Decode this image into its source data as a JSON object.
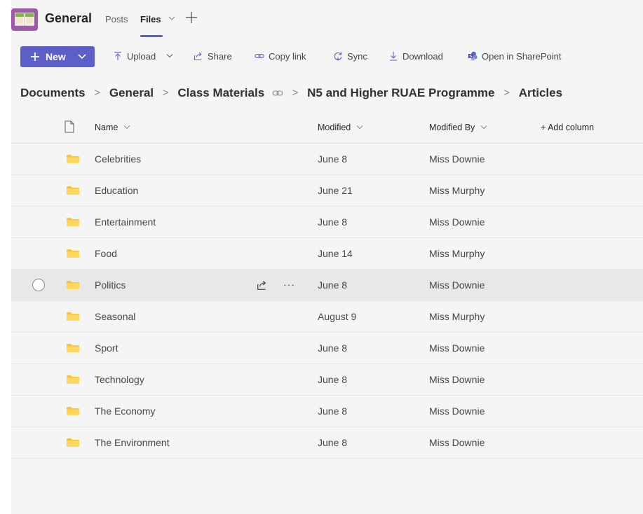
{
  "header": {
    "channel": "General",
    "tabs": [
      {
        "label": "Posts"
      },
      {
        "label": "Files"
      }
    ]
  },
  "toolbar": {
    "new_label": "New",
    "upload_label": "Upload",
    "share_label": "Share",
    "copylink_label": "Copy link",
    "sync_label": "Sync",
    "download_label": "Download",
    "sharepoint_label": "Open in SharePoint"
  },
  "breadcrumb": [
    "Documents",
    "General",
    "Class Materials",
    "N5 and Higher RUAE Programme",
    "Articles"
  ],
  "table": {
    "columns": {
      "name": "Name",
      "modified": "Modified",
      "modified_by": "Modified By",
      "add_column": "+ Add column"
    },
    "rows": [
      {
        "name": "Celebrities",
        "modified": "June 8",
        "by": "Miss Downie"
      },
      {
        "name": "Education",
        "modified": "June 21",
        "by": "Miss Murphy"
      },
      {
        "name": "Entertainment",
        "modified": "June 8",
        "by": "Miss Downie"
      },
      {
        "name": "Food",
        "modified": "June 14",
        "by": "Miss Murphy"
      },
      {
        "name": "Politics",
        "modified": "June 8",
        "by": "Miss Downie"
      },
      {
        "name": "Seasonal",
        "modified": "August 9",
        "by": "Miss Murphy"
      },
      {
        "name": "Sport",
        "modified": "June 8",
        "by": "Miss Downie"
      },
      {
        "name": "Technology",
        "modified": "June 8",
        "by": "Miss Downie"
      },
      {
        "name": "The Economy",
        "modified": "June 8",
        "by": "Miss Downie"
      },
      {
        "name": "The Environment",
        "modified": "June 8",
        "by": "Miss Downie"
      }
    ],
    "more_label": "···"
  },
  "colors": {
    "accent": "#5b5fc7",
    "folder": "#f8c53a",
    "app_logo": "#9c5aa8"
  }
}
